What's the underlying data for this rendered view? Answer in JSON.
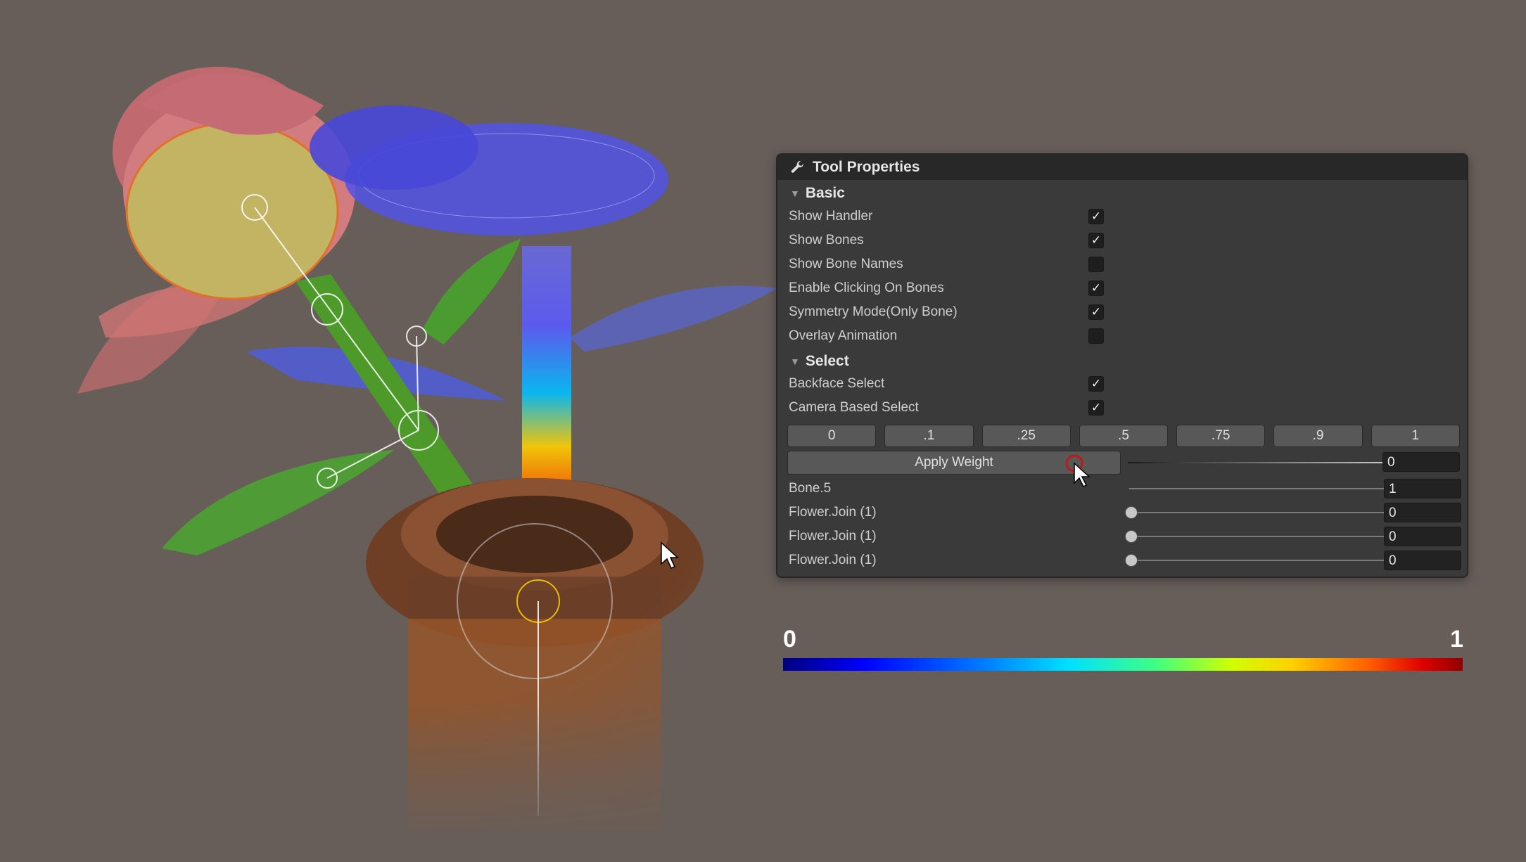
{
  "panel": {
    "title": "Tool Properties",
    "title_icon": "wrench-icon",
    "sections": {
      "basic": "Basic",
      "select": "Select"
    },
    "basic_options": [
      {
        "label": "Show Handler",
        "checked": true
      },
      {
        "label": "Show Bones",
        "checked": true
      },
      {
        "label": "Show Bone Names",
        "checked": false
      },
      {
        "label": "Enable Clicking On Bones",
        "checked": true
      },
      {
        "label": "Symmetry Mode(Only Bone)",
        "checked": true
      },
      {
        "label": "Overlay Animation",
        "checked": false
      }
    ],
    "select_options": [
      {
        "label": "Backface Select",
        "checked": true
      },
      {
        "label": "Camera Based Select",
        "checked": true
      }
    ],
    "weight_presets": [
      "0",
      ".1",
      ".25",
      ".5",
      ".75",
      ".9",
      "1"
    ],
    "apply_weight": {
      "label": "Apply Weight",
      "slider_value": 1,
      "field_value": "0"
    },
    "bones": [
      {
        "name": "Bone.5",
        "value": "1",
        "slider": 1
      },
      {
        "name": "Flower.Join (1)",
        "value": "0",
        "slider": 0
      },
      {
        "name": "Flower.Join (1)",
        "value": "0",
        "slider": 0
      },
      {
        "name": "Flower.Join (1)",
        "value": "0",
        "slider": 0
      }
    ]
  },
  "gradient": {
    "min_label": "0",
    "max_label": "1",
    "colors": [
      "#000080",
      "#0000ff",
      "#00e0ff",
      "#40ff80",
      "#ffd000",
      "#ff6000",
      "#900000"
    ]
  },
  "colors": {
    "background": "#675e5a",
    "panel_bg": "#3a3a3a",
    "header_bg": "#282828",
    "button_bg": "#585858"
  }
}
